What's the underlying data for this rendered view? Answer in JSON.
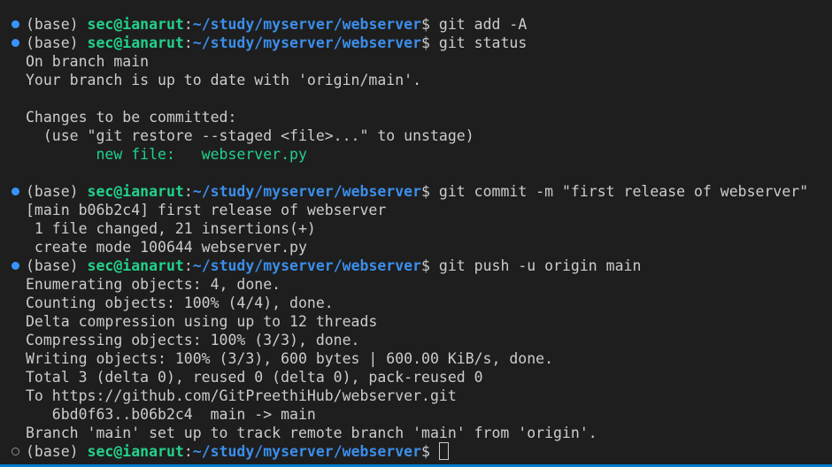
{
  "prompt": {
    "env": "(base)",
    "user_host": "sec@ianarut",
    "sep": ":",
    "path": "~/study/myserver/webserver",
    "symbol": "$"
  },
  "lines": [
    {
      "kind": "command",
      "status": "done",
      "command": "git add -A"
    },
    {
      "kind": "command",
      "status": "done",
      "command": "git status"
    },
    {
      "kind": "output",
      "text": "On branch main"
    },
    {
      "kind": "output",
      "text": "Your branch is up to date with 'origin/main'."
    },
    {
      "kind": "blank",
      "text": ""
    },
    {
      "kind": "output",
      "text": "Changes to be committed:"
    },
    {
      "kind": "output",
      "text": "  (use \"git restore --staged <file>...\" to unstage)"
    },
    {
      "kind": "output",
      "text": "\tnew file:   webserver.py",
      "color": "green"
    },
    {
      "kind": "blank",
      "text": ""
    },
    {
      "kind": "command",
      "status": "done",
      "command": "git commit -m \"first release of webserver\""
    },
    {
      "kind": "output",
      "text": "[main b06b2c4] first release of webserver"
    },
    {
      "kind": "output",
      "text": " 1 file changed, 21 insertions(+)"
    },
    {
      "kind": "output",
      "text": " create mode 100644 webserver.py"
    },
    {
      "kind": "command",
      "status": "done",
      "command": "git push -u origin main"
    },
    {
      "kind": "output",
      "text": "Enumerating objects: 4, done."
    },
    {
      "kind": "output",
      "text": "Counting objects: 100% (4/4), done."
    },
    {
      "kind": "output",
      "text": "Delta compression using up to 12 threads"
    },
    {
      "kind": "output",
      "text": "Compressing objects: 100% (3/3), done."
    },
    {
      "kind": "output",
      "text": "Writing objects: 100% (3/3), 600 bytes | 600.00 KiB/s, done."
    },
    {
      "kind": "output",
      "text": "Total 3 (delta 0), reused 0 (delta 0), pack-reused 0"
    },
    {
      "kind": "output",
      "text": "To https://github.com/GitPreethiHub/webserver.git"
    },
    {
      "kind": "output",
      "text": "   6bd0f63..b06b2c4  main -> main"
    },
    {
      "kind": "output",
      "text": "Branch 'main' set up to track remote branch 'main' from 'origin'."
    },
    {
      "kind": "command",
      "status": "pending",
      "command": "",
      "cursor": true
    }
  ],
  "colors": {
    "background": "#1e1e1e",
    "foreground": "#cccccc",
    "user_host": "#23d18b",
    "path": "#3b8eea",
    "staged_file": "#23d18b",
    "decoration_done": "#3794ff",
    "decoration_pending": "#8c8c8c",
    "accent_bar": "#007acc"
  }
}
